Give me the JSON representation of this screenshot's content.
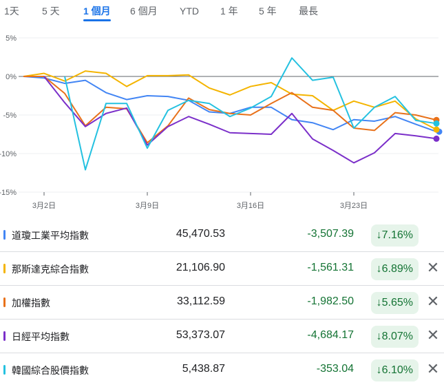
{
  "tabs": [
    "1天",
    "5 天",
    "1 個月",
    "6 個月",
    "YTD",
    "1 年",
    "5 年",
    "最長"
  ],
  "active_tab": 2,
  "chart_data": {
    "type": "line",
    "y_ticks": [
      "5%",
      "0%",
      "-5%",
      "-10%",
      "-15%"
    ],
    "y_tick_values": [
      5,
      0,
      -5,
      -10,
      -15
    ],
    "ylim": [
      -15,
      5
    ],
    "x_count": 21,
    "x_ticks": [
      {
        "index": 1,
        "label": "3月2日"
      },
      {
        "index": 6,
        "label": "3月9日"
      },
      {
        "index": 11,
        "label": "3月16日"
      },
      {
        "index": 16,
        "label": "3月23日"
      }
    ],
    "series": [
      {
        "name": "道瓊工業平均指數",
        "color": "#4285f4",
        "values": [
          0,
          -0.2,
          -0.9,
          -0.5,
          -2.1,
          -3.0,
          -2.5,
          -2.6,
          -3.1,
          -4.6,
          -4.8,
          -4.0,
          -4.0,
          -5.6,
          -6.0,
          -6.9,
          -5.6,
          -5.8,
          -5.2,
          -6.2,
          -7.16
        ]
      },
      {
        "name": "那斯達克綜合指數",
        "color": "#f4b400",
        "values": [
          0,
          0.4,
          -0.6,
          0.7,
          0.4,
          -1.3,
          0.1,
          0.1,
          0.2,
          -1.5,
          -2.4,
          -1.3,
          -0.8,
          -2.3,
          -2.5,
          -4.4,
          -3.2,
          -4.0,
          -3.2,
          -5.5,
          -6.89
        ]
      },
      {
        "name": "加權指數",
        "color": "#e8711a",
        "values": [
          0,
          0,
          -2.2,
          -6.4,
          -4.0,
          -4.2,
          -8.6,
          -6.4,
          -2.8,
          -4.3,
          -4.8,
          -5.0,
          -3.5,
          -2.1,
          -4.0,
          -4.4,
          -6.7,
          -7.0,
          -4.7,
          -5.0,
          -5.65
        ]
      },
      {
        "name": "日經平均指數",
        "color": "#7b2fc9",
        "values": [
          null,
          0,
          -3.4,
          -6.5,
          -4.8,
          -4.1,
          -8.9,
          -6.5,
          -5.2,
          -6.2,
          -7.3,
          -7.4,
          -7.5,
          -4.8,
          -8.1,
          -9.6,
          -11.2,
          -9.9,
          -7.4,
          -7.7,
          -8.07
        ]
      },
      {
        "name": "韓國綜合股價指數",
        "color": "#24c1e0",
        "values": [
          null,
          null,
          0,
          -12.1,
          -3.5,
          -3.5,
          -9.3,
          -4.4,
          -3.1,
          -3.5,
          -5.2,
          -4.1,
          -2.6,
          2.4,
          -0.5,
          -0.1,
          -6.7,
          -4.0,
          -2.6,
          -5.7,
          -6.1
        ]
      }
    ]
  },
  "rows": [
    {
      "name": "道瓊工業平均指數",
      "color": "#4285f4",
      "price": "45,470.53",
      "change": "-3,507.39",
      "pct": "↓7.16%",
      "removable": false
    },
    {
      "name": "那斯達克綜合指數",
      "color": "#f4b400",
      "price": "21,106.90",
      "change": "-1,561.31",
      "pct": "↓6.89%",
      "removable": true
    },
    {
      "name": "加權指數",
      "color": "#e8711a",
      "price": "33,112.59",
      "change": "-1,982.50",
      "pct": "↓5.65%",
      "removable": true
    },
    {
      "name": "日經平均指數",
      "color": "#7b2fc9",
      "price": "53,373.07",
      "change": "-4,684.17",
      "pct": "↓8.07%",
      "removable": true
    },
    {
      "name": "韓國綜合股價指數",
      "color": "#24c1e0",
      "price": "5,438.87",
      "change": "-353.04",
      "pct": "↓6.10%",
      "removable": true
    }
  ],
  "remove_label": "✕"
}
